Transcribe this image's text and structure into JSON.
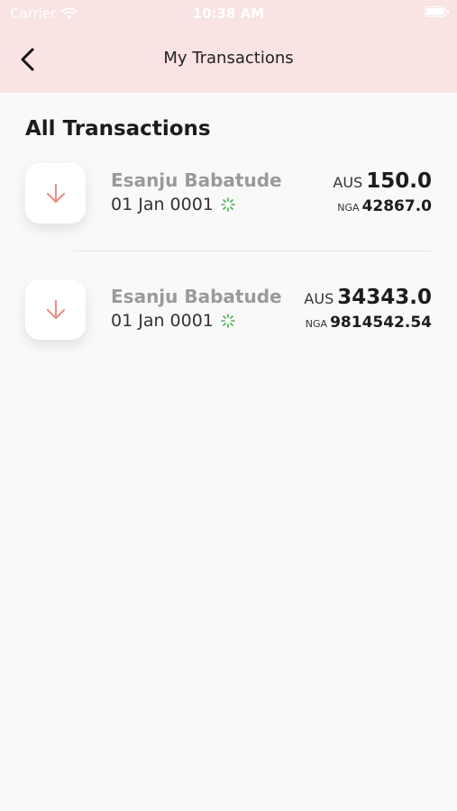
{
  "status_bar": {
    "carrier": "Carrier",
    "time": "10:38 AM"
  },
  "nav": {
    "title": "My Transactions",
    "back_icon": "chevron-left-icon"
  },
  "section": {
    "title": "All Transactions"
  },
  "colors": {
    "header_bg": "#f9e3e3",
    "arrow": "#e8908a",
    "spinner": "#4caf50"
  },
  "transactions": [
    {
      "name": "Esanju Babatude",
      "date": "01 Jan 0001",
      "currency_main": "AUS",
      "amount_main": "150.0",
      "currency_sub": "NGA",
      "amount_sub": "42867.0",
      "icon": "arrow-down-icon",
      "status_icon": "loading-spinner-icon"
    },
    {
      "name": "Esanju Babatude",
      "date": "01 Jan 0001",
      "currency_main": "AUS",
      "amount_main": "34343.0",
      "currency_sub": "NGA",
      "amount_sub": "9814542.54",
      "icon": "arrow-down-icon",
      "status_icon": "loading-spinner-icon"
    }
  ]
}
